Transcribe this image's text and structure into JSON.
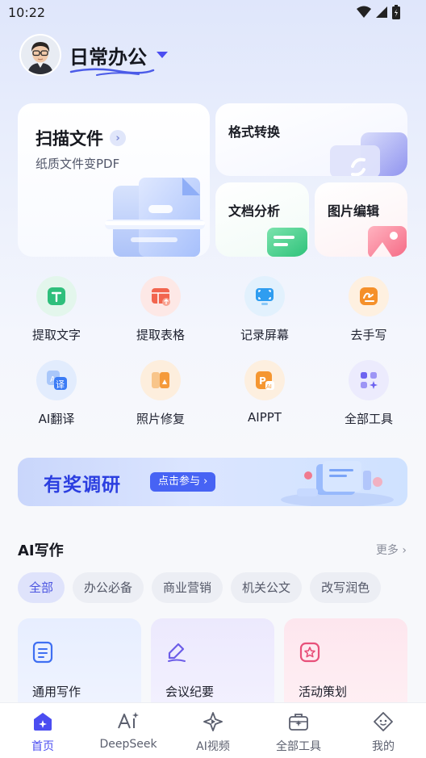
{
  "status": {
    "time": "10:22"
  },
  "header": {
    "title": "日常办公"
  },
  "cards": {
    "scan": {
      "title": "扫描文件",
      "subtitle": "纸质文件变PDF"
    },
    "format": {
      "title": "格式转换"
    },
    "doc": {
      "title": "文档分析"
    },
    "image": {
      "title": "图片编辑"
    }
  },
  "tools": [
    {
      "label": "提取文字",
      "icon": "text-scan-icon",
      "color": "#2fbf7c"
    },
    {
      "label": "提取表格",
      "icon": "table-icon",
      "color": "#f2654f"
    },
    {
      "label": "记录屏幕",
      "icon": "screen-record-icon",
      "color": "#2f9df0"
    },
    {
      "label": "去手写",
      "icon": "erase-handwriting-icon",
      "color": "#f5902a"
    },
    {
      "label": "AI翻译",
      "icon": "translate-icon",
      "color": "#3c7cf5"
    },
    {
      "label": "照片修复",
      "icon": "photo-repair-icon",
      "color": "#f59a3a"
    },
    {
      "label": "AIPPT",
      "icon": "ppt-icon",
      "color": "#f59630"
    },
    {
      "label": "全部工具",
      "icon": "grid-icon",
      "color": "#6d63f0"
    }
  ],
  "banner": {
    "title": "有奖调研",
    "button": "点击参与 ›"
  },
  "ai_writing": {
    "title": "AI写作",
    "more": "更多 ›",
    "chips": [
      "全部",
      "办公必备",
      "商业营销",
      "机关公文",
      "改写润色"
    ],
    "cards": [
      "通用写作",
      "会议纪要",
      "活动策划"
    ]
  },
  "nav": [
    "首页",
    "DeepSeek",
    "AI视频",
    "全部工具",
    "我的"
  ],
  "colors": {
    "accent": "#4b4df1",
    "banner_text": "#2b3ee0"
  }
}
